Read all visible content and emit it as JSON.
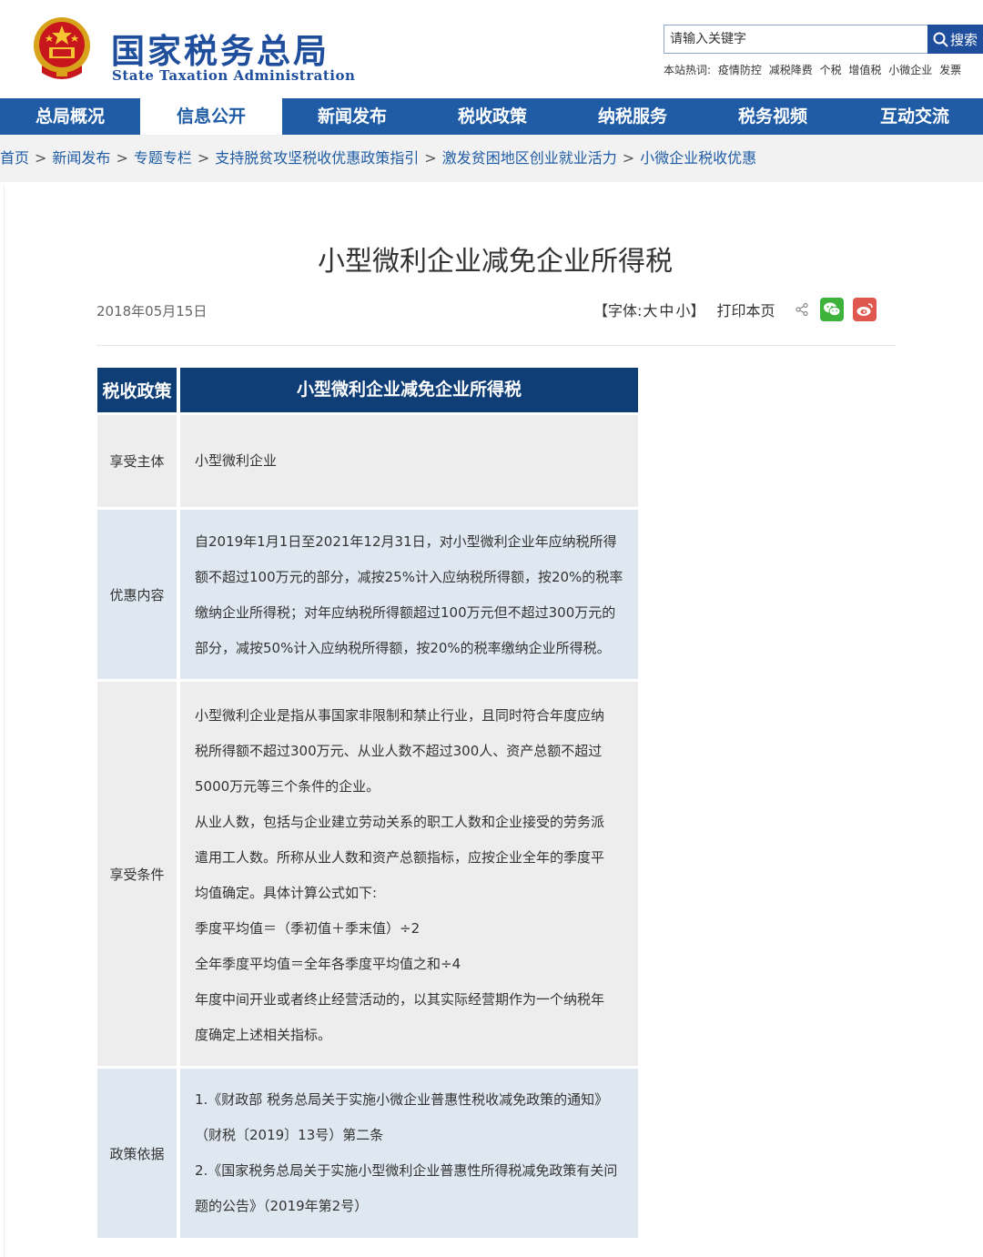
{
  "header": {
    "logo_cn": "国家税务总局",
    "logo_en": "State Taxation Administration",
    "search_placeholder": "请输入关键字",
    "search_button": "搜索",
    "hot_label": "本站热词:",
    "hot_words": [
      "疫情防控",
      "减税降费",
      "个税",
      "增值税",
      "小微企业",
      "发票"
    ]
  },
  "nav": [
    "总局概况",
    "信息公开",
    "新闻发布",
    "税收政策",
    "纳税服务",
    "税务视频",
    "互动交流"
  ],
  "nav_active": "信息公开",
  "breadcrumb": [
    "首页",
    "新闻发布",
    "专题专栏",
    "支持脱贫攻坚税收优惠政策指引",
    "激发贫困地区创业就业活力",
    "小微企业税收优惠"
  ],
  "breadcrumb_sep": ">",
  "article": {
    "title": "小型微利企业减免企业所得税",
    "date": "2018年05月15日",
    "font_label": "【字体:",
    "font_large": "大",
    "font_medium": "中",
    "font_small": "小】",
    "print": "打印本页"
  },
  "table": {
    "header_left": "税收政策",
    "header_right": "小型微利企业减免企业所得税",
    "rows": [
      {
        "label": "享受主体",
        "lines": [
          "小型微利企业"
        ]
      },
      {
        "label": "优惠内容",
        "lines": [
          "自2019年1月1日至2021年12月31日，对小型微利企业年应纳税所得",
          "额不超过100万元的部分，减按25%计入应纳税所得额，按20%的税率",
          "缴纳企业所得税；对年应纳税所得额超过100万元但不超过300万元的",
          "部分，减按50%计入应纳税所得额，按20%的税率缴纳企业所得税。"
        ]
      },
      {
        "label": "享受条件",
        "lines": [
          "小型微利企业是指从事国家非限制和禁止行业，且同时符合年度应纳",
          "税所得额不超过300万元、从业人数不超过300人、资产总额不超过",
          "5000万元等三个条件的企业。",
          "从业人数，包括与企业建立劳动关系的职工人数和企业接受的劳务派",
          "遣用工人数。所称从业人数和资产总额指标，应按企业全年的季度平",
          "均值确定。具体计算公式如下:",
          "季度平均值＝（季初值＋季末值）÷2",
          "全年季度平均值＝全年各季度平均值之和÷4",
          "年度中间开业或者终止经营活动的，以其实际经营期作为一个纳税年",
          "度确定上述相关指标。"
        ]
      },
      {
        "label": "政策依据",
        "lines": [
          "1.《财政部 税务总局关于实施小微企业普惠性税收减免政策的通知》",
          "（财税〔2019〕13号）第二条",
          "2.《国家税务总局关于实施小型微利企业普惠性所得税减免政策有关问",
          "题的公告》（2019年第2号）"
        ]
      }
    ]
  },
  "colors": {
    "brand_blue": "#1f4e9c",
    "nav_blue": "#1f5ca5",
    "table_header": "#0f3d76",
    "row_gray": "#ededed",
    "row_blue": "#dfe8f1"
  }
}
